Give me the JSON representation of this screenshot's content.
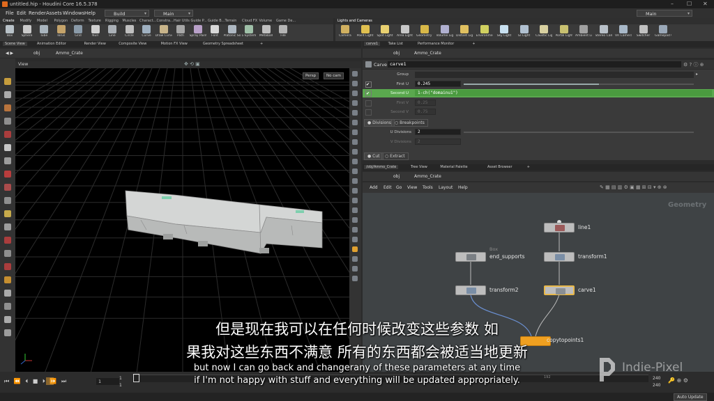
{
  "window": {
    "title": "untitled.hip - Houdini Core 16.5.378",
    "min": "–",
    "max": "☐",
    "close": "✕"
  },
  "menubar": {
    "items": [
      "File",
      "Edit",
      "Render",
      "Assets",
      "Windows",
      "Help"
    ],
    "build": "Build",
    "main_desktop": "Main",
    "right_desktop": "Main"
  },
  "shelf": {
    "tabs": [
      "Create",
      "Modify",
      "Model",
      "Polygon",
      "Deform",
      "Texture",
      "Rigging",
      "Muscles",
      "Charact...",
      "Constra...",
      "Hair Utils",
      "Guide P...",
      "Guide B...",
      "Terrain",
      "Cloud FX",
      "Volume",
      "Game De..."
    ],
    "tools": [
      "Box",
      "Sphere",
      "Tube",
      "Torus",
      "Grid",
      "Null",
      "Line",
      "Circle",
      "Curve",
      "Draw Curve",
      "Path",
      "Spray Paint",
      "Font",
      "Platonic Solids",
      "L-System",
      "Metaball",
      "File"
    ]
  },
  "shelf2": {
    "tabs": [
      "Lights and Cameras"
    ],
    "tools": [
      "Camera",
      "Point Light",
      "Spot Light",
      "Area Light",
      "Geometry Light",
      "Volume Light",
      "Distant Light",
      "Environment Light",
      "Sky Light",
      "GI Light",
      "Caustic Light",
      "Portal Light",
      "Ambient Light",
      "Stereo Camera",
      "VR Camera",
      "Switcher",
      "Gamepad Camera"
    ]
  },
  "viewer_tabs": [
    "Scene View",
    "Animation Editor",
    "Render View",
    "Composite View",
    "Motion FX View",
    "Geometry Spreadsheet"
  ],
  "viewer": {
    "path": [
      "obj",
      "Ammo_Crate"
    ],
    "view_label": "View",
    "persp": "Persp",
    "cam": "No cam"
  },
  "param_tabs": [
    "carve1",
    "Take List",
    "Performance Monitor"
  ],
  "params": {
    "path": [
      "obj",
      "Ammo_Crate"
    ],
    "node_type": "Carve",
    "node_name": "carve1",
    "group_label": "Group",
    "group_value": "",
    "first_u_label": "First U",
    "first_u": "0.245",
    "second_u_label": "Second U",
    "second_u": "1-ch(\"domainu1\")",
    "first_v_label": "First V",
    "first_v": "0.25",
    "second_v_label": "Second V",
    "second_v": "0.75",
    "divisions": "Divisions",
    "breakpoints": "Breakpoints",
    "u_div_label": "U Divisions",
    "u_div": "2",
    "v_div_label": "V Divisions",
    "v_div": "2",
    "cut": "Cut",
    "extract": "Extract",
    "first_u_fraction": 0.245
  },
  "network_tabs": [
    "/obj/Ammo_Crate",
    "Tree View",
    "Material Palette",
    "Asset Browser"
  ],
  "network": {
    "path": [
      "obj",
      "Ammo_Crate"
    ],
    "menu": [
      "Add",
      "Edit",
      "Go",
      "View",
      "Tools",
      "Layout",
      "Help"
    ],
    "context": "Geometry",
    "nodes": {
      "line1": "line1",
      "transform1": "transform1",
      "carve1": "carve1",
      "end_supports": "end_supports",
      "box_hint": "Box",
      "transform2": "transform2",
      "copytopoints1": "copytopoints1"
    }
  },
  "timeline": {
    "frame": "1",
    "start": "1",
    "start2": "1",
    "mid_tick": "192",
    "end": "240",
    "end2": "240",
    "auto_update": "Auto Update"
  },
  "subtitles": {
    "zh_line1": "但是现在我可以在任何时候改变这些参数 如",
    "zh_line2": "果我对这些东西不满意 所有的东西都会被适当地更新",
    "en_line1": "but now I can go back and changerany of these parameters at any time",
    "en_line2": "if I'm not happy with stuff and everything will be updated appropriately."
  },
  "watermark": "Indie-Pixel",
  "colors": {
    "accent_green": "#5aa84e",
    "node_selected": "#e8b84a",
    "wire": "#6a8fd0",
    "copy_node": "#f0a020"
  }
}
